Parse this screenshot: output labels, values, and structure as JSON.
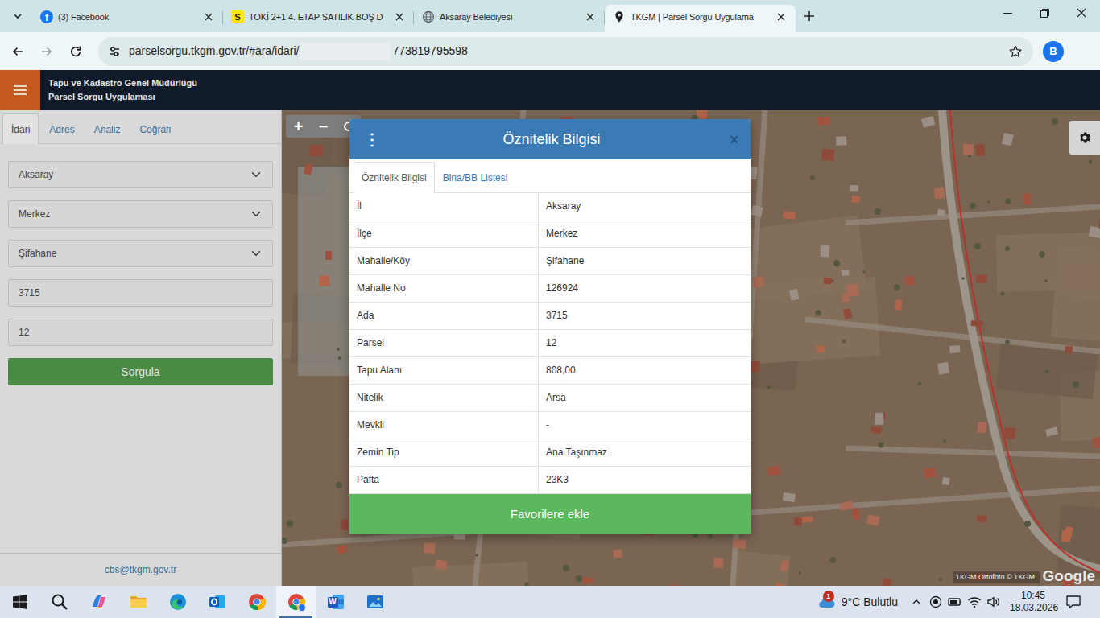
{
  "browser": {
    "tabs": [
      {
        "kind": "facebook",
        "glyph": "f",
        "title": "(3) Facebook",
        "selected": false
      },
      {
        "kind": "sahibinden",
        "glyph": "S",
        "title": "TOKİ 2+1 4. ETAP SATILIK BOŞ D",
        "selected": false
      },
      {
        "kind": "globe",
        "title": "Aksaray Belediyesi",
        "selected": false
      },
      {
        "kind": "pin",
        "title": "TKGM | Parsel Sorgu Uygulama",
        "selected": true
      }
    ],
    "address": {
      "prefix": "parselsorgu.tkgm.gov.tr/#ara/idari/",
      "suffix": "773819795598"
    },
    "profile": "B"
  },
  "header": {
    "org": "Tapu ve Kadastro Genel Müdürlüğü",
    "app": "Parsel Sorgu Uygulaması"
  },
  "sidebar": {
    "tabs": [
      {
        "label": "İdari",
        "selected": true
      },
      {
        "label": "Adres",
        "selected": false
      },
      {
        "label": "Analiz",
        "selected": false
      },
      {
        "label": "Coğrafi",
        "selected": false
      }
    ],
    "fields": [
      {
        "kind": "select",
        "value": "Aksaray"
      },
      {
        "kind": "select",
        "value": "Merkez"
      },
      {
        "kind": "select",
        "value": "Şifahane"
      },
      {
        "kind": "input",
        "value": "3715"
      },
      {
        "kind": "input",
        "value": "12"
      }
    ],
    "button": "Sorgula",
    "footer": "cbs@tkgm.gov.tr"
  },
  "map": {
    "controls": [
      "+",
      "−"
    ],
    "attribution": {
      "text": "TKGM Ortofoto ©",
      "link": "TKGM.",
      "brand": "Google"
    }
  },
  "modal": {
    "menu": "⋮",
    "title": "Öznitelik Bilgisi",
    "close": "×",
    "tabs": [
      {
        "label": "Öznitelik Bilgisi",
        "selected": true
      },
      {
        "label": "Bina/BB Listesi",
        "selected": false
      }
    ],
    "rows": [
      [
        "İl",
        "Aksaray"
      ],
      [
        "İlçe",
        "Merkez"
      ],
      [
        "Mahalle/Köy",
        "Şifahane"
      ],
      [
        "Mahalle No",
        "126924"
      ],
      [
        "Ada",
        "3715"
      ],
      [
        "Parsel",
        "12"
      ],
      [
        "Tapu Alanı",
        "808,00"
      ],
      [
        "Nitelik",
        "Arsa"
      ],
      [
        "Mevkii",
        "-"
      ],
      [
        "Zemin Tip",
        "Ana Taşınmaz"
      ],
      [
        "Pafta",
        "23K3"
      ]
    ],
    "button": "Favorilere ekle"
  },
  "taskbar": {
    "apps": [
      {
        "kind": "start",
        "selected": false
      },
      {
        "kind": "search",
        "selected": false
      },
      {
        "kind": "copilot",
        "selected": false
      },
      {
        "kind": "explorer",
        "selected": false
      },
      {
        "kind": "edge",
        "selected": false
      },
      {
        "kind": "outlook",
        "selected": false
      },
      {
        "kind": "chrome",
        "selected": false
      },
      {
        "kind": "chrome-profile",
        "selected": true
      },
      {
        "kind": "word",
        "glyph": "W",
        "selected": false
      },
      {
        "kind": "photos",
        "selected": false
      }
    ],
    "weather": {
      "badge": "1",
      "temp": "9°C",
      "condition": "Bulutlu"
    },
    "time": "10:45",
    "date": "18.03.2026"
  }
}
